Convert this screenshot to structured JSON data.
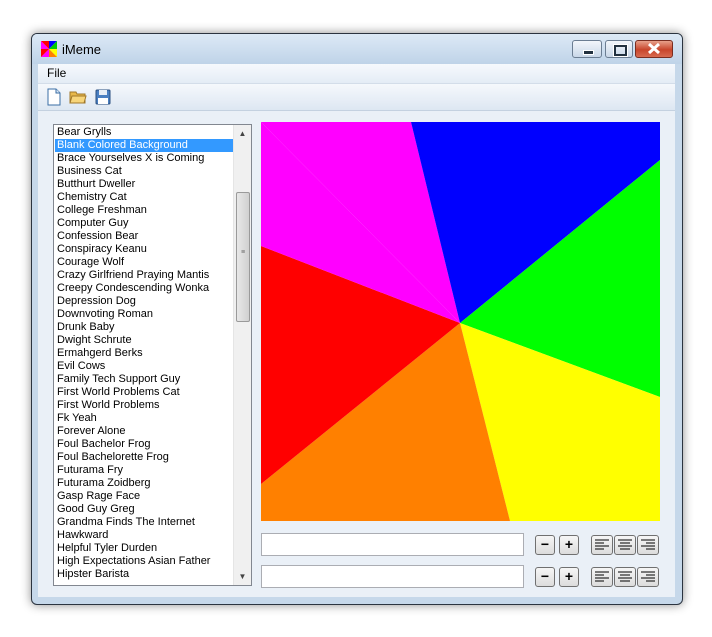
{
  "window": {
    "title": "iMeme"
  },
  "menu": {
    "file": "File"
  },
  "toolbar": {
    "new_icon": "new-document-icon",
    "open_icon": "open-folder-icon",
    "save_icon": "save-disk-icon"
  },
  "memes": [
    "Bear Grylls",
    "Blank Colored Background",
    "Brace Yourselves X is Coming",
    "Business Cat",
    "Butthurt Dweller",
    "Chemistry Cat",
    "College Freshman",
    "Computer Guy",
    "Confession Bear",
    "Conspiracy Keanu",
    "Courage Wolf",
    "Crazy Girlfriend Praying Mantis",
    "Creepy Condescending Wonka",
    "Depression Dog",
    "Downvoting Roman",
    "Drunk Baby",
    "Dwight Schrute",
    "Ermahgerd Berks",
    "Evil Cows",
    "Family Tech Support Guy",
    "First World Problems Cat",
    "First World Problems",
    "Fk Yeah",
    "Forever Alone",
    "Foul Bachelor Frog",
    "Foul Bachelorette Frog",
    "Futurama Fry",
    "Futurama Zoidberg",
    "Gasp Rage Face",
    "Good Guy Greg",
    "Grandma Finds The Internet",
    "Hawkward",
    "Helpful Tyler Durden",
    "High Expectations Asian Father",
    "Hipster Barista"
  ],
  "selected_index": 1,
  "top_text": {
    "value": "",
    "minus": "−",
    "plus": "+"
  },
  "bottom_text": {
    "value": "",
    "minus": "−",
    "plus": "+"
  },
  "colors": {
    "slice1": "#ff00ff",
    "slice2": "#0000ff",
    "slice3": "#00ff00",
    "slice4": "#ffff00",
    "slice5": "#ff8000",
    "slice6": "#ff0000"
  }
}
